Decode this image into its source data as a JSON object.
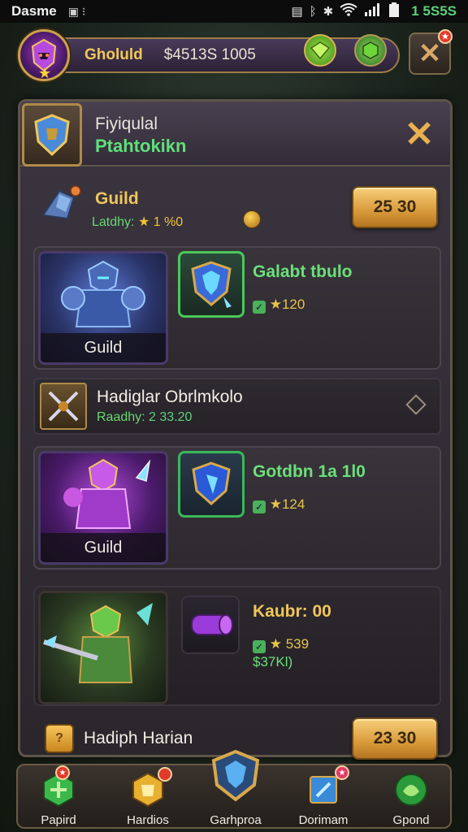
{
  "status_bar": {
    "carrier": "Dasme",
    "mid": "▣ ⁝",
    "icons": [
      "sim-icon",
      "bluetooth-icon",
      "vibrate-icon",
      "wifi-icon",
      "signal-icon",
      "battery-icon"
    ],
    "time": "1 5S5S"
  },
  "hud": {
    "player_name": "Gholuld",
    "gold": "$4513S 1005"
  },
  "panel": {
    "title": "Fiyiqulal",
    "subtitle": "Ptahtokikn",
    "guild_row": {
      "title": "Guild",
      "sub_label": "Latdhy:",
      "sub_value": "★ 1 %0",
      "button": "25 30"
    },
    "card1": {
      "portrait_label": "Guild",
      "title": "Galabt tbulo",
      "stat": "★120"
    },
    "mid_row": {
      "title": "Hadiglar Obrlmkolo",
      "sub_label": "Raadhy:",
      "sub_value": "2 33.20"
    },
    "card2": {
      "portrait_label": "Guild",
      "title": "Gotdbn 1a 1l0",
      "stat": "★124"
    },
    "card3": {
      "title": "Kaubr: 00",
      "stat": "★ 539",
      "price": "$37Kl)"
    },
    "bottom_row": {
      "title": "Hadiph Harian",
      "button": "23 30"
    }
  },
  "bottom_nav": [
    {
      "label": "Papird"
    },
    {
      "label": "Hardios"
    },
    {
      "label": "Garhproa"
    },
    {
      "label": "Dorimam"
    },
    {
      "label": "Gpond"
    }
  ],
  "colors": {
    "accent_gold": "#f0c75a",
    "accent_green": "#6be07a",
    "panel_bg": "#2d292f",
    "button_gold": "#d89a3a"
  }
}
